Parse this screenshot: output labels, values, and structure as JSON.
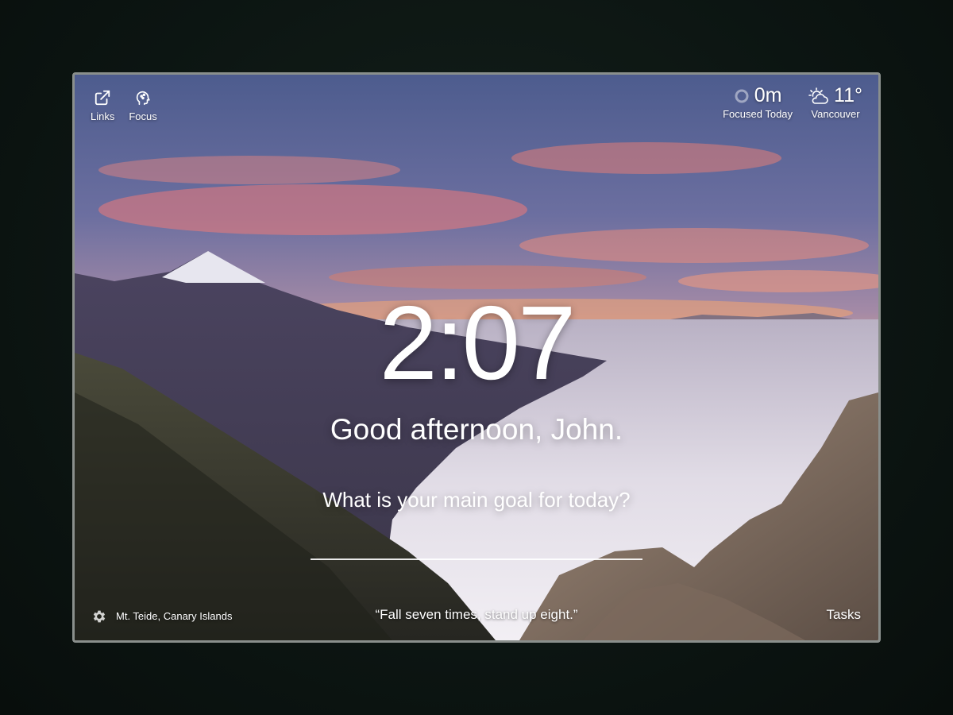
{
  "nav": {
    "links_label": "Links",
    "focus_label": "Focus"
  },
  "focus_widget": {
    "value": "0m",
    "label": "Focused Today"
  },
  "weather": {
    "temperature": "11°",
    "location": "Vancouver",
    "icon": "partly-cloudy-icon"
  },
  "main": {
    "time": "2:07",
    "greeting": "Good afternoon, John.",
    "goal_prompt": "What is your main goal for today?",
    "goal_value": ""
  },
  "footer": {
    "photo_location": "Mt. Teide, Canary Islands",
    "quote": "“Fall seven times, stand up eight.”",
    "tasks_label": "Tasks"
  },
  "colors": {
    "text": "#ffffff",
    "frame_border": "#8a8f8c",
    "page_background": "#0c1512"
  }
}
